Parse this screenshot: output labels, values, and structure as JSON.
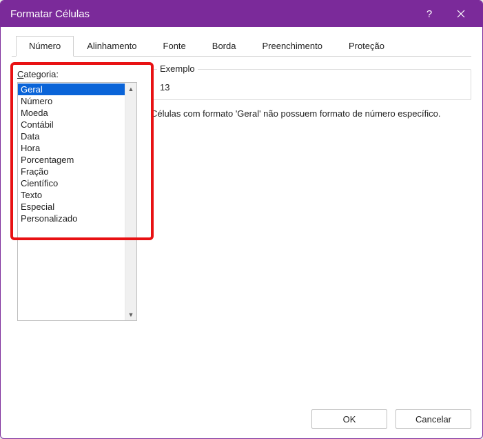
{
  "dialog": {
    "title": "Formatar Células"
  },
  "tabs": {
    "t0": "Número",
    "t1": "Alinhamento",
    "t2": "Fonte",
    "t3": "Borda",
    "t4": "Preenchimento",
    "t5": "Proteção"
  },
  "categoria": {
    "label_rest": "ategoria:",
    "items": {
      "i0": "Geral",
      "i1": "Número",
      "i2": "Moeda",
      "i3": "Contábil",
      "i4": "Data",
      "i5": "Hora",
      "i6": "Porcentagem",
      "i7": "Fração",
      "i8": "Científico",
      "i9": "Texto",
      "i10": "Especial",
      "i11": "Personalizado"
    }
  },
  "exemplo": {
    "legend": "Exemplo",
    "value": "13"
  },
  "description": "Células com formato 'Geral' não possuem formato de número específico.",
  "footer": {
    "ok": "OK",
    "cancel": "Cancelar"
  }
}
